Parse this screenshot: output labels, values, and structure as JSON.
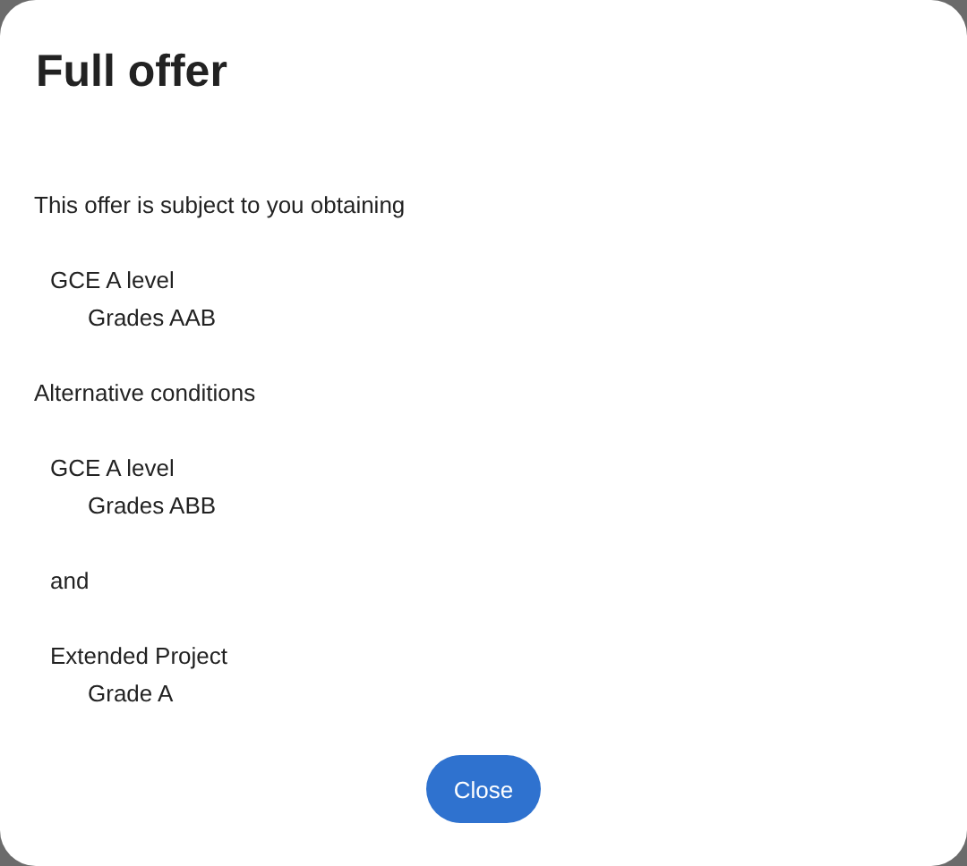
{
  "dialog": {
    "title": "Full offer",
    "intro": "This offer is subject to you obtaining",
    "conditions": [
      {
        "kind": "requirement",
        "qualification": "GCE A level",
        "grade": "Grades AAB"
      }
    ],
    "alternative_heading": "Alternative conditions",
    "alternative_conditions": [
      {
        "kind": "requirement",
        "qualification": "GCE A level",
        "grade": "Grades ABB"
      },
      {
        "kind": "connector",
        "text": "and"
      },
      {
        "kind": "requirement",
        "qualification": "Extended Project",
        "grade": "Grade A"
      }
    ],
    "button": "Close"
  }
}
